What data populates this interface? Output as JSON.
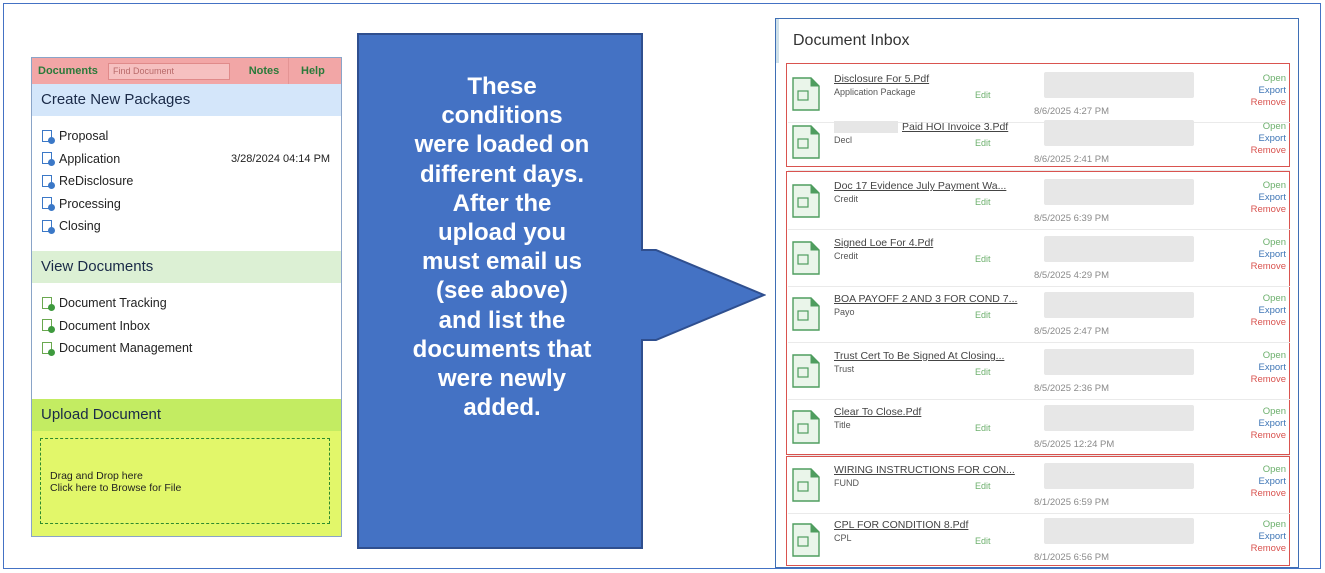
{
  "left_panel": {
    "header": {
      "documents_label": "Documents",
      "find_placeholder": "Find Document",
      "notes_label": "Notes",
      "help_label": "Help"
    },
    "create_section": {
      "title": "Create New Packages",
      "items": [
        {
          "label": "Proposal",
          "date": ""
        },
        {
          "label": "Application",
          "date": "3/28/2024 04:14 PM"
        },
        {
          "label": "ReDisclosure",
          "date": ""
        },
        {
          "label": "Processing",
          "date": ""
        },
        {
          "label": "Closing",
          "date": ""
        }
      ]
    },
    "view_section": {
      "title": "View Documents",
      "items": [
        {
          "label": "Document Tracking"
        },
        {
          "label": "Document Inbox"
        },
        {
          "label": "Document Management"
        }
      ]
    },
    "upload_section": {
      "title": "Upload Document",
      "line1": "Drag and Drop here",
      "line2": "Click here to Browse for File"
    }
  },
  "arrow": {
    "text": "These conditions were loaded on different days. After the upload you must email us (see above) and list the documents that were newly added.",
    "lines": [
      "These",
      "conditions",
      "were loaded on",
      "different days.",
      "After the",
      "upload you",
      "must email us",
      "(see above)",
      "and list the",
      "documents that",
      "were newly",
      "added."
    ],
    "fill_color": "#4472c4",
    "stroke_color": "#2f4f8f"
  },
  "document_inbox": {
    "title": "Document Inbox",
    "actions": {
      "open": "Open",
      "export": "Export",
      "remove": "Remove",
      "edit": "Edit"
    },
    "rows": [
      {
        "name": "Disclosure For 5.Pdf",
        "type": "Application Package",
        "date": "8/6/2025 4:27 PM"
      },
      {
        "name": "Paid HOI Invoice 3.Pdf",
        "type": "Decl",
        "date": "8/6/2025 2:41 PM"
      },
      {
        "name": "Doc 17 Evidence July Payment Wa...",
        "type": "Credit",
        "date": "8/5/2025 6:39 PM"
      },
      {
        "name": "Signed Loe For 4.Pdf",
        "type": "Credit",
        "date": "8/5/2025 4:29 PM"
      },
      {
        "name": "BOA PAYOFF 2 AND 3 FOR COND 7...",
        "type": "Payo",
        "date": "8/5/2025 2:47 PM"
      },
      {
        "name": "Trust Cert To Be Signed At Closing...",
        "type": "Trust",
        "date": "8/5/2025 2:36 PM"
      },
      {
        "name": "Clear To Close.Pdf",
        "type": "Title",
        "date": "8/5/2025 12:24 PM"
      },
      {
        "name": "WIRING INSTRUCTIONS FOR CON...",
        "type": "FUND",
        "date": "8/1/2025 6:59 PM"
      },
      {
        "name": "CPL FOR CONDITION 8.Pdf",
        "type": "CPL",
        "date": "8/1/2025 6:56 PM"
      }
    ]
  },
  "colors": {
    "frame": "#4472c4",
    "group_border": "#d9534f",
    "header_pink": "#f2a6a6",
    "section_blue": "#d4e6fa",
    "section_green": "#dcf0d4",
    "section_lime": "#c3ec62"
  }
}
